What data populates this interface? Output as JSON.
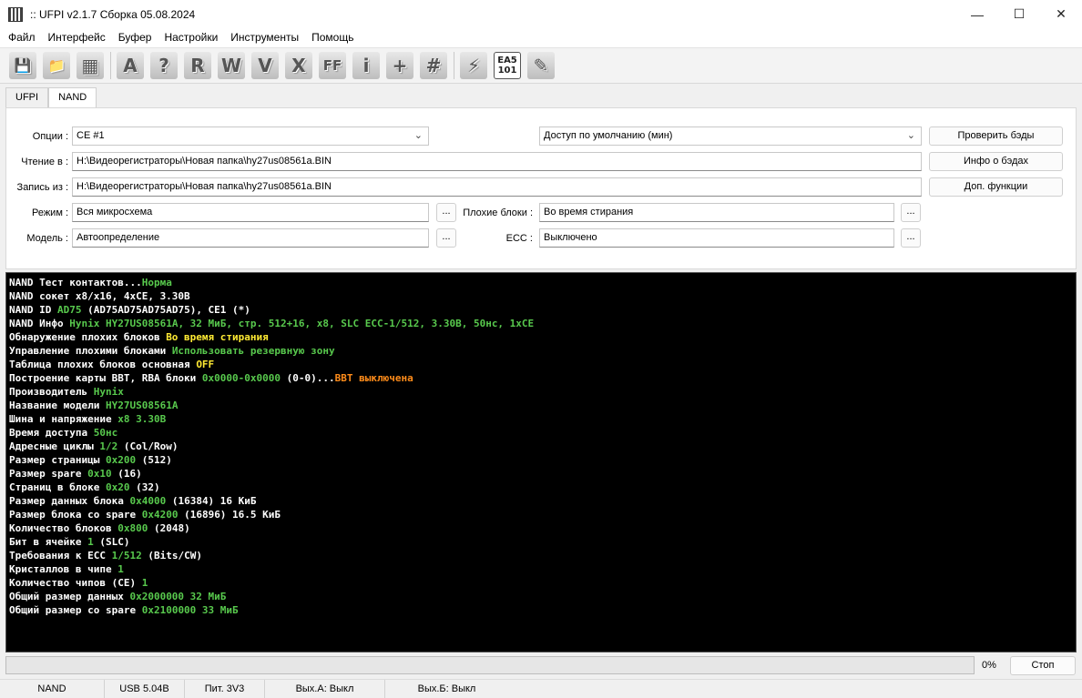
{
  "window": {
    "title": ":: UFPI v2.1.7 Сборка 05.08.2024",
    "minimize": "—",
    "maximize": "☐",
    "close": "✕"
  },
  "menu": [
    "Файл",
    "Интерфейс",
    "Буфер",
    "Настройки",
    "Инструменты",
    "Помощь"
  ],
  "toolbar": [
    {
      "name": "save-icon",
      "glyph": "💾"
    },
    {
      "name": "open-folder-icon",
      "glyph": "📁"
    },
    {
      "name": "chip-icon",
      "glyph": "▦"
    },
    {
      "name": "read-auto-icon",
      "glyph": "A"
    },
    {
      "name": "identify-icon",
      "glyph": "?"
    },
    {
      "name": "read-icon",
      "glyph": "R"
    },
    {
      "name": "write-icon",
      "glyph": "W"
    },
    {
      "name": "verify-icon",
      "glyph": "V"
    },
    {
      "name": "erase-icon",
      "glyph": "X"
    },
    {
      "name": "blank-check-icon",
      "glyph": "FF"
    },
    {
      "name": "info-icon",
      "glyph": "i"
    },
    {
      "name": "add-icon",
      "glyph": "+"
    },
    {
      "name": "checksum-icon",
      "glyph": "#"
    },
    {
      "name": "power-icon",
      "glyph": "⚡"
    },
    {
      "name": "ea5-icon",
      "glyph": "EA5 101"
    },
    {
      "name": "notes-icon",
      "glyph": "✎"
    }
  ],
  "tabs": [
    "UFPI",
    "NAND"
  ],
  "form": {
    "options_label": "Опции :",
    "options_value": "CE #1",
    "access_value": "Доступ по умолчанию (мин)",
    "read_label": "Чтение в :",
    "read_value": "H:\\Видеорегистраторы\\Новая папка\\hy27us08561a.BIN",
    "write_label": "Запись из :",
    "write_value": "H:\\Видеорегистраторы\\Новая папка\\hy27us08561a.BIN",
    "mode_label": "Режим :",
    "mode_value": "Вся микросхема",
    "bad_blocks_label": "Плохие блоки :",
    "bad_blocks_value": "Во время стирания",
    "model_label": "Модель :",
    "model_value": "Автоопределение",
    "ecc_label": "ECC :",
    "ecc_value": "Выключено",
    "dots": "...",
    "check_bad_btn": "Проверить бэды",
    "bad_info_btn": "Инфо о бэдах",
    "extra_funcs_btn": "Доп. функции"
  },
  "console": [
    [
      [
        "NAND Тест контактов...",
        "w"
      ],
      [
        "Норма",
        "g"
      ]
    ],
    [
      [
        "NAND сокет x8/x16, 4xCE, 3.30В",
        "w"
      ]
    ],
    [
      [
        "NAND ID ",
        "w"
      ],
      [
        "AD75",
        "g"
      ],
      [
        " (AD75AD75AD75AD75), CE1 (*)",
        "w"
      ]
    ],
    [
      [
        "NAND Инфо ",
        "w"
      ],
      [
        "Hynix HY27US08561A, 32 МиБ, стр. 512+16, x8, SLC ECC-1/512, 3.30В, 50нс, 1xCE",
        "g"
      ]
    ],
    [
      [
        "Обнаружение плохих блоков ",
        "w"
      ],
      [
        "Во время стирания",
        "y"
      ]
    ],
    [
      [
        "Управление плохими блоками ",
        "w"
      ],
      [
        "Использовать резервную зону",
        "g"
      ]
    ],
    [
      [
        "Таблица плохих блоков основная ",
        "w"
      ],
      [
        "OFF",
        "y"
      ]
    ],
    [
      [
        "Построение карты BBT, RBA блоки ",
        "w"
      ],
      [
        "0x0000-0x0000",
        "g"
      ],
      [
        " (0-0)...",
        "w"
      ],
      [
        "BBT выключена",
        "o"
      ]
    ],
    [
      [
        "Производитель ",
        "w"
      ],
      [
        "Hynix",
        "g"
      ]
    ],
    [
      [
        "Название модели ",
        "w"
      ],
      [
        "HY27US08561A",
        "g"
      ]
    ],
    [
      [
        "Шина и напряжение ",
        "w"
      ],
      [
        "x8 3.30В",
        "g"
      ]
    ],
    [
      [
        "Время доступа ",
        "w"
      ],
      [
        "50нс",
        "g"
      ]
    ],
    [
      [
        "Адресные циклы ",
        "w"
      ],
      [
        "1/2",
        "g"
      ],
      [
        " (Col/Row)",
        "w"
      ]
    ],
    [
      [
        "Размер страницы ",
        "w"
      ],
      [
        "0x200",
        "g"
      ],
      [
        " (512)",
        "w"
      ]
    ],
    [
      [
        "Размер spare ",
        "w"
      ],
      [
        "0x10",
        "g"
      ],
      [
        " (16)",
        "w"
      ]
    ],
    [
      [
        "Страниц в блоке ",
        "w"
      ],
      [
        "0x20",
        "g"
      ],
      [
        " (32)",
        "w"
      ]
    ],
    [
      [
        "Размер данных блока ",
        "w"
      ],
      [
        "0x4000",
        "g"
      ],
      [
        " (16384) 16 КиБ",
        "w"
      ]
    ],
    [
      [
        "Размер блока со spare ",
        "w"
      ],
      [
        "0x4200",
        "g"
      ],
      [
        " (16896) 16.5 КиБ",
        "w"
      ]
    ],
    [
      [
        "Количество блоков ",
        "w"
      ],
      [
        "0x800",
        "g"
      ],
      [
        " (2048)",
        "w"
      ]
    ],
    [
      [
        "Бит в ячейке ",
        "w"
      ],
      [
        "1",
        "g"
      ],
      [
        " (SLC)",
        "w"
      ]
    ],
    [
      [
        "Требования к ECC ",
        "w"
      ],
      [
        "1/512",
        "g"
      ],
      [
        " (Bits/CW)",
        "w"
      ]
    ],
    [
      [
        "Кристаллов в чипе ",
        "w"
      ],
      [
        "1",
        "g"
      ]
    ],
    [
      [
        "Количество чипов (CE) ",
        "w"
      ],
      [
        "1",
        "g"
      ]
    ],
    [
      [
        "Общий размер данных ",
        "w"
      ],
      [
        "0x2000000 32 МиБ",
        "g"
      ]
    ],
    [
      [
        "Общий размер со spare ",
        "w"
      ],
      [
        "0x2100000 33 МиБ",
        "g"
      ]
    ]
  ],
  "progress": {
    "percent_text": "0%",
    "fraction": 0,
    "stop_label": "Стоп"
  },
  "status": [
    "NAND",
    "USB 5.04В",
    "Пит. 3V3",
    "Вых.А: Выкл",
    "Вых.Б: Выкл"
  ]
}
